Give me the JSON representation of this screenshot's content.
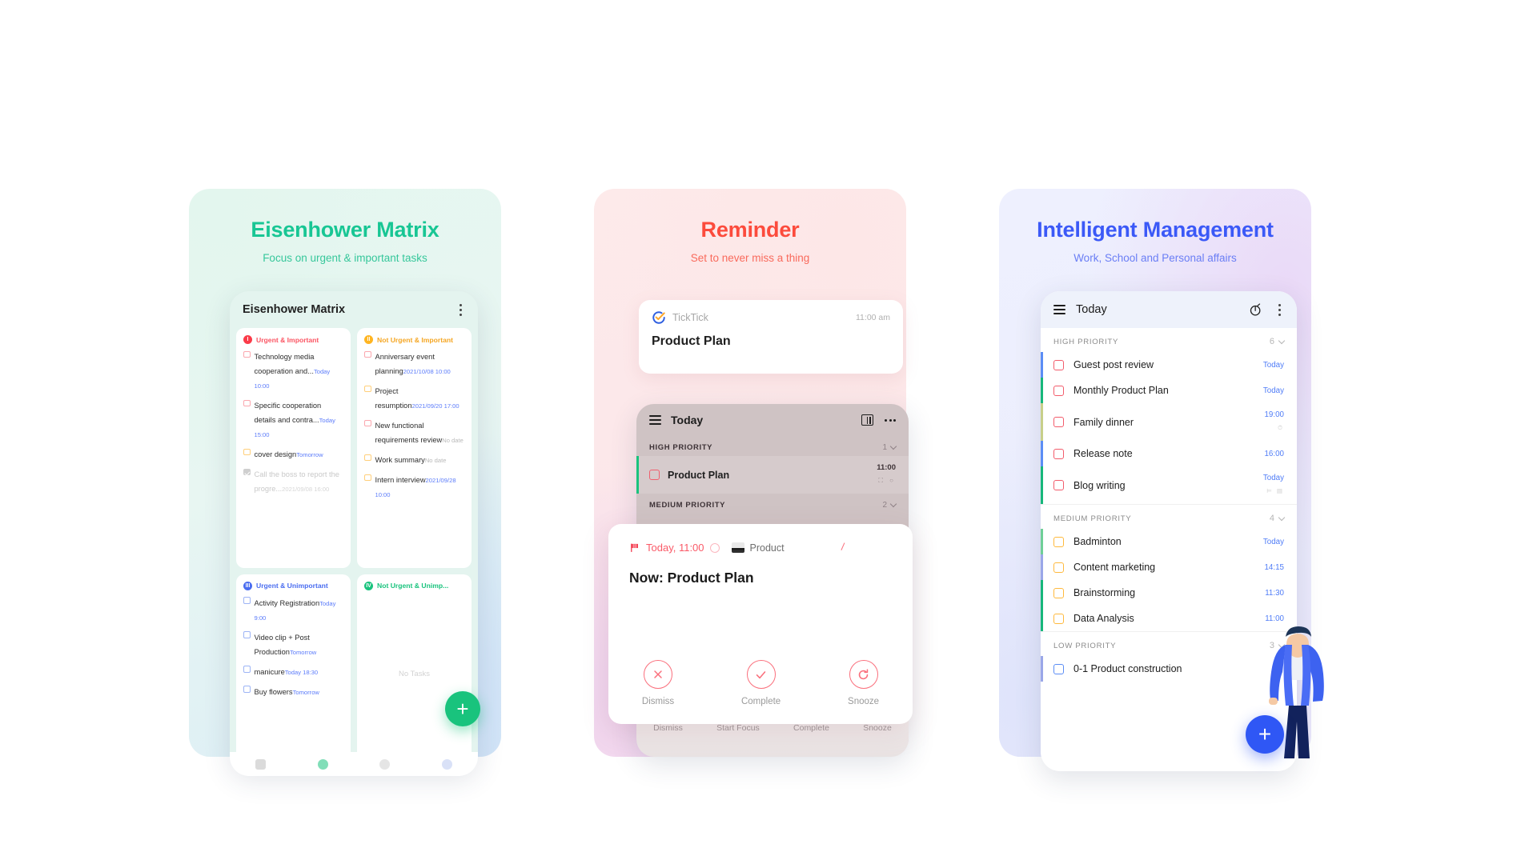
{
  "panels": {
    "eisenhower": {
      "title": "Eisenhower Matrix",
      "subtitle": "Focus on urgent & important tasks",
      "accent": "#18c694",
      "app": {
        "header_title": "Eisenhower Matrix",
        "menu_icon": "kebab-menu-icon",
        "fab_label": "+",
        "quadrants": [
          {
            "badge": "I",
            "label": "Urgent & Important",
            "color": "#fb5563",
            "empty_text": "",
            "tasks": [
              {
                "name": "Technology media cooperation and...",
                "date": "Today 10:00",
                "check": "red",
                "done": false
              },
              {
                "name": "Specific cooperation details and contra...",
                "date": "Today 15:00",
                "check": "red",
                "done": false
              },
              {
                "name": "cover design",
                "date": "Tomorrow",
                "check": "yellow",
                "done": false
              },
              {
                "name": "Call the boss to report the progre...",
                "date": "2021/09/08 16:00",
                "check": "grey",
                "done": true
              }
            ]
          },
          {
            "badge": "II",
            "label": "Not Urgent & Important",
            "color": "#f5a623",
            "empty_text": "",
            "tasks": [
              {
                "name": "Anniversary event planning",
                "date": "2021/10/08 10:00",
                "check": "red",
                "done": false
              },
              {
                "name": "Project resumption",
                "date": "2021/09/20 17:00",
                "check": "yellow",
                "done": false
              },
              {
                "name": "New functional requirements review",
                "date": "No date",
                "check": "red",
                "done": false
              },
              {
                "name": "Work summary",
                "date": "No date",
                "check": "yellow",
                "done": false
              },
              {
                "name": "Intern interview",
                "date": "2021/09/28 10:00",
                "check": "yellow",
                "done": false
              }
            ]
          },
          {
            "badge": "III",
            "label": "Urgent & Unimportant",
            "color": "#4a6df0",
            "empty_text": "",
            "tasks": [
              {
                "name": "Activity Registration",
                "date": "Today 9:00",
                "check": "blue",
                "done": false
              },
              {
                "name": "Video clip + Post Production",
                "date": "Tomorrow",
                "check": "blue",
                "done": false
              },
              {
                "name": "manicure",
                "date": "Today 18:30",
                "check": "blue",
                "done": false
              },
              {
                "name": "Buy flowers",
                "date": "Tomorrow",
                "check": "blue",
                "done": false
              }
            ]
          },
          {
            "badge": "IV",
            "label": "Not Urgent & Unimp...",
            "color": "#19c37d",
            "empty_text": "No Tasks",
            "tasks": []
          }
        ]
      }
    },
    "reminder": {
      "title": "Reminder",
      "subtitle": "Set to never miss a thing",
      "accent": "#fc4b3c",
      "notification": {
        "app_name": "TickTick",
        "time": "11:00 am",
        "title": "Product Plan",
        "logo_icon": "ticktick-logo-icon"
      },
      "app": {
        "header_title": "Today",
        "menu_icon": "hamburger-icon",
        "view_icon": "column-view-icon",
        "more_icon": "more-horizontal-icon",
        "sections": [
          {
            "label": "HIGH PRIORITY",
            "count": "1",
            "tasks": [
              {
                "name": "Product Plan",
                "time": "11:00",
                "sub": "⛶ ○"
              }
            ]
          },
          {
            "label": "MEDIUM PRIORITY",
            "count": "2",
            "tasks": []
          }
        ],
        "footer_actions": [
          "Dismiss",
          "Start Focus",
          "Complete",
          "Snooze"
        ]
      },
      "dialog": {
        "flag_icon": "red-flag-icon",
        "when": "Today, 11:00",
        "repeat_icon": "repeat-ring-icon",
        "project_icon": "monitor-icon",
        "project": "Product",
        "title": "Now: Product Plan",
        "actions": [
          {
            "label": "Dismiss",
            "icon": "close-circle-icon"
          },
          {
            "label": "Complete",
            "icon": "check-circle-icon"
          },
          {
            "label": "Snooze",
            "icon": "refresh-circle-icon"
          }
        ]
      }
    },
    "intelligent": {
      "title": "Intelligent Management",
      "subtitle": "Work, School and Personal affairs",
      "accent": "#3b59f7",
      "app": {
        "header_title": "Today",
        "menu_icon": "hamburger-icon",
        "focus_icon": "pomodoro-timer-icon",
        "more_icon": "kebab-menu-icon",
        "fab_label": "+",
        "sections": [
          {
            "label": "HIGH PRIORITY",
            "count": "6",
            "level": "high",
            "tasks": [
              {
                "name": "Guest post review",
                "time": "Today",
                "sub": "",
                "bar": "#5b8df5"
              },
              {
                "name": "Monthly Product Plan",
                "time": "Today",
                "sub": "",
                "bar": "#17b77a"
              },
              {
                "name": "Family dinner",
                "time": "19:00",
                "sub": "⏱",
                "bar": "#c7cf8a"
              },
              {
                "name": "Release note",
                "time": "16:00",
                "sub": "",
                "bar": "#5b8df5"
              },
              {
                "name": "Blog writing",
                "time": "Today",
                "sub": "⊨ ▤",
                "bar": "#17b77a"
              }
            ]
          },
          {
            "label": "MEDIUM PRIORITY",
            "count": "4",
            "level": "med",
            "tasks": [
              {
                "name": "Badminton",
                "time": "Today",
                "sub": "",
                "bar": "#6fcf97"
              },
              {
                "name": "Content marketing",
                "time": "14:15",
                "sub": "",
                "bar": "#9aa7e8"
              },
              {
                "name": "Brainstorming",
                "time": "11:30",
                "sub": "",
                "bar": "#17b77a"
              },
              {
                "name": "Data Analysis",
                "time": "11:00",
                "sub": "",
                "bar": "#17b77a"
              }
            ]
          },
          {
            "label": "LOW PRIORITY",
            "count": "3",
            "level": "low",
            "tasks": [
              {
                "name": "0-1 Product construction",
                "time": "",
                "sub": "",
                "bar": "#9aa7e8"
              }
            ]
          }
        ]
      }
    }
  }
}
